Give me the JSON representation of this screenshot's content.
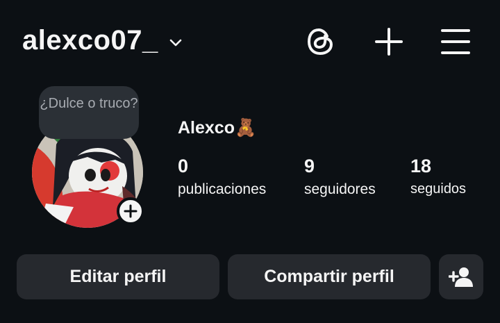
{
  "header": {
    "username": "alexco07_",
    "icons": [
      "chevron-down-icon",
      "threads-icon",
      "plus-icon",
      "menu-icon"
    ]
  },
  "profile": {
    "note": "¿Dulce o truco?",
    "display_name": "Alexco🧸",
    "stats": [
      {
        "value": "0",
        "label": "publicaciones"
      },
      {
        "value": "9",
        "label": "seguidores"
      },
      {
        "value": "18",
        "label": "seguidos"
      }
    ]
  },
  "actions": {
    "edit": "Editar perfil",
    "share": "Compartir perfil",
    "discover_icon": "add-person-icon"
  },
  "colors": {
    "background": "#0c1014",
    "button": "#26292e",
    "text": "#f5f5f5",
    "note_bubble": "#2b3036"
  }
}
